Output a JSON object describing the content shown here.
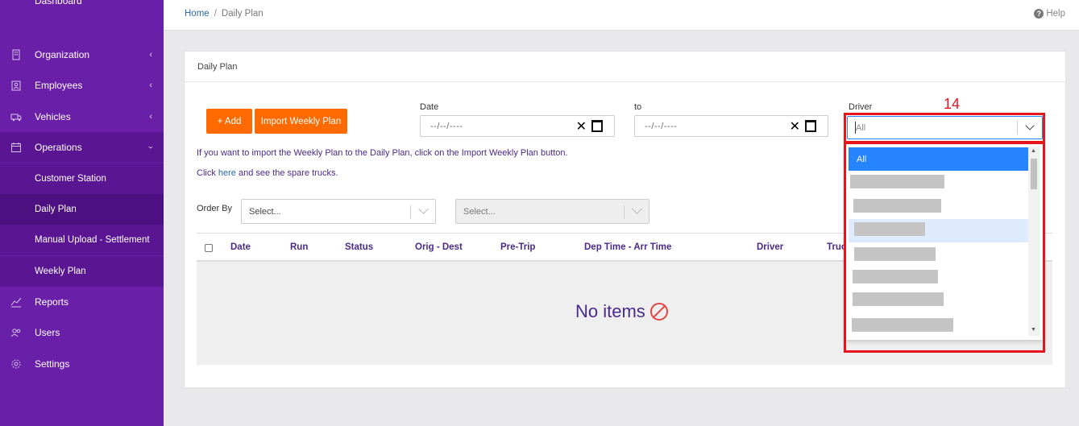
{
  "sidebar": {
    "items": [
      {
        "label": "Organization",
        "icon": "building-icon"
      },
      {
        "label": "Employees",
        "icon": "id-badge-icon"
      },
      {
        "label": "Vehicles",
        "icon": "truck-icon"
      },
      {
        "label": "Operations",
        "icon": "calendar-icon"
      },
      {
        "label": "Reports",
        "icon": "chart-line-icon"
      },
      {
        "label": "Users",
        "icon": "users-icon"
      },
      {
        "label": "Settings",
        "icon": "gear-icon"
      }
    ],
    "operations_children": [
      "Customer Station",
      "Daily Plan",
      "Manual Upload - Settlement",
      "Weekly Plan"
    ],
    "top_partial_label": "Dashboard"
  },
  "header": {
    "breadcrumb_home": "Home",
    "breadcrumb_sep": "/",
    "breadcrumb_current": "Daily Plan",
    "help_label": "Help"
  },
  "card": {
    "title": "Daily Plan",
    "add_button": "+ Add",
    "import_button": "Import Weekly Plan",
    "date_label": "Date",
    "to_label": "to",
    "driver_label": "Driver",
    "date_placeholder": "--/--/----",
    "to_placeholder": "--/--/----",
    "info_line_1": "If you want to import the Weekly Plan to the Daily Plan, click on the Import Weekly Plan button.",
    "info_click": "Click",
    "info_here": "here",
    "info_rest": "and see the spare trucks.",
    "order_by_label": "Order By",
    "order_select_placeholder": "Select...",
    "order_dir_placeholder": "Select...",
    "columns": [
      "Date",
      "Run",
      "Status",
      "Orig - Dest",
      "Pre-Trip",
      "Dep Time - Arr Time",
      "Driver",
      "Truck"
    ],
    "empty_message": "No items"
  },
  "driver_select": {
    "value": "All",
    "options": [
      "All"
    ]
  },
  "annotation": {
    "label": "14",
    "color": "#e8141c"
  },
  "colors": {
    "sidebar_bg": "#6a1fa8",
    "accent_orange": "#ff6a00",
    "select_blue": "#2684ff",
    "heading_purple": "#4a2a8a"
  }
}
